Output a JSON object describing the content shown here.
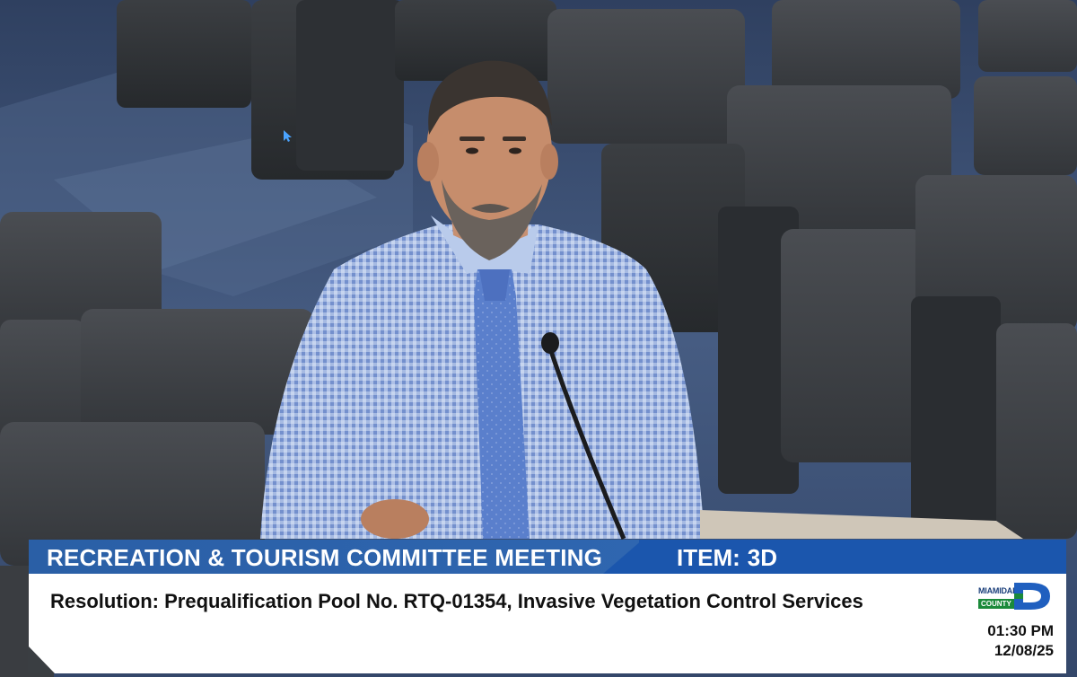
{
  "lower_third": {
    "committee": "RECREATION & TOURISM COMMITTEE MEETING",
    "item_label": "ITEM:",
    "item_value": "3D",
    "resolution": "Resolution: Prequalification Pool No. RTQ-01354, Invasive Vegetation Control Services",
    "time": "01:30 PM",
    "date": "12/08/25"
  },
  "logo": {
    "word1": "MIAMIDADE",
    "word2": "COUNTY"
  },
  "scene": {
    "subject": "speaker-at-podium",
    "icons": [
      "mouse-cursor-icon",
      "microphone-icon"
    ]
  },
  "colors": {
    "banner_blue": "#2a5fa6",
    "banner_blue_dark": "#1b56ad",
    "logo_green": "#1b8a3a",
    "logo_navy": "#1a3e7a",
    "shirt_blue": "#a9bfe6",
    "tie_blue": "#5277c9",
    "seat_gray": "#3f4246",
    "carpet_blue": "#3b4d6e"
  }
}
